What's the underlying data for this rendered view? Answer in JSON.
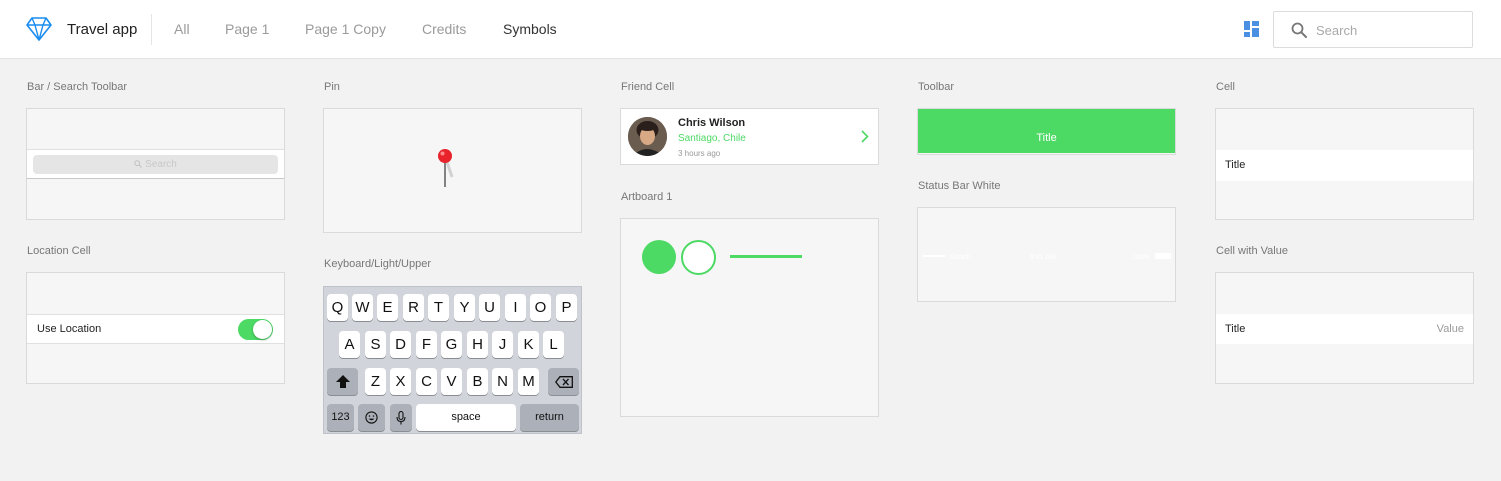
{
  "header": {
    "app_title": "Travel app",
    "tabs": [
      {
        "label": "All",
        "active": false
      },
      {
        "label": "Page 1",
        "active": false
      },
      {
        "label": "Page 1 Copy",
        "active": false
      },
      {
        "label": "Credits",
        "active": false
      },
      {
        "label": "Symbols",
        "active": true
      }
    ],
    "search": {
      "placeholder": "Search",
      "value": ""
    }
  },
  "symbols": {
    "bar_search_toolbar": {
      "label": "Bar / Search Toolbar",
      "search_placeholder": "Search"
    },
    "location_cell": {
      "label": "Location Cell",
      "row_text": "Use Location",
      "toggle_on": true
    },
    "pin": {
      "label": "Pin"
    },
    "keyboard": {
      "label": "Keyboard/Light/Upper",
      "row1": [
        "Q",
        "W",
        "E",
        "R",
        "T",
        "Y",
        "U",
        "I",
        "O",
        "P"
      ],
      "row2": [
        "A",
        "S",
        "D",
        "F",
        "G",
        "H",
        "J",
        "K",
        "L"
      ],
      "row3": [
        "Z",
        "X",
        "C",
        "V",
        "B",
        "N",
        "M"
      ],
      "numbers_key": "123",
      "space_key": "space",
      "return_key": "return"
    },
    "friend_cell": {
      "label": "Friend Cell",
      "name": "Chris Wilson",
      "location": "Santiago, Chile",
      "time": "3 hours ago"
    },
    "artboard_1": {
      "label": "Artboard 1"
    },
    "toolbar": {
      "label": "Toolbar",
      "title": "Title"
    },
    "status_bar_white": {
      "label": "Status Bar White",
      "carrier": "Sketch",
      "time": "9:41 AM",
      "battery": "100%"
    },
    "cell": {
      "label": "Cell",
      "title": "Title"
    },
    "cell_with_value": {
      "label": "Cell with Value",
      "title": "Title",
      "value": "Value"
    }
  },
  "colors": {
    "accent": "#4cd964",
    "brand": "#1a8cf0"
  },
  "icons": {
    "logo": "sketch-diamond-icon",
    "layout": "layout-grid-icon",
    "search": "search-icon"
  }
}
